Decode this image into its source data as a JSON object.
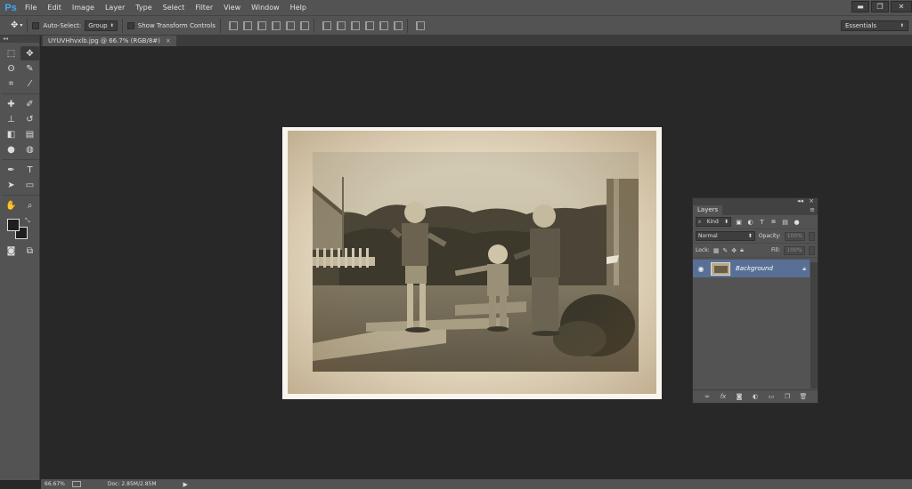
{
  "app": {
    "logo": "Ps",
    "menu": [
      "File",
      "Edit",
      "Image",
      "Layer",
      "Type",
      "Select",
      "Filter",
      "View",
      "Window",
      "Help"
    ],
    "window_controls": {
      "minimize": "▬",
      "restore": "❐",
      "close": "✕"
    }
  },
  "options": {
    "auto_select_label": "Auto-Select:",
    "auto_select_value": "Group",
    "show_transform_label": "Show Transform Controls",
    "workspace": "Essentials"
  },
  "document": {
    "tab_label": "UYUVHhvxlb.jpg @ 66.7% (RGB/8#)",
    "tab_close": "×"
  },
  "status": {
    "zoom": "66.67%",
    "doc_info": "Doc: 2.85M/2.85M",
    "arrow": "▶"
  },
  "layers": {
    "tab": "Layers",
    "menu_icon": "≡",
    "collapse": "◂◂",
    "close": "×",
    "kind": "Kind",
    "blend_mode": "Normal",
    "opacity_label": "Opacity:",
    "opacity_value": "100%",
    "lock_label": "Lock:",
    "fill_label": "Fill:",
    "fill_value": "100%",
    "items": [
      {
        "name": "Background",
        "visible": true,
        "locked": true
      }
    ]
  },
  "colors": {
    "accent": "#3fa9f5",
    "layer_selected": "#587096",
    "panel": "#535353",
    "canvas_bg": "#282828"
  }
}
